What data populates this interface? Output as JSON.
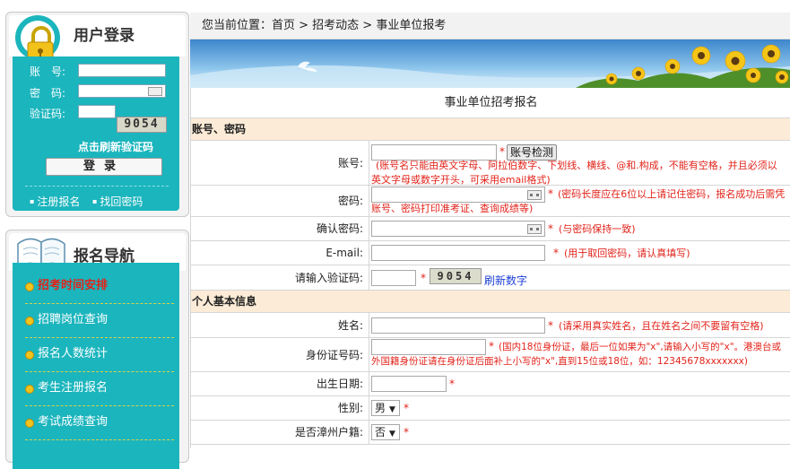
{
  "login": {
    "title": "用户登录",
    "account_label": "账　号:",
    "password_label": "密　码:",
    "captcha_label": "验证码:",
    "captcha_text": "9054",
    "refresh_link": "点击刷新验证码",
    "login_button": "登录",
    "register_link": "注册报名",
    "forgot_link": "找回密码"
  },
  "nav": {
    "title": "报名导航",
    "items": [
      {
        "label": "招考时间安排",
        "active": true
      },
      {
        "label": "招聘岗位查询"
      },
      {
        "label": "报名人数统计"
      },
      {
        "label": "考生注册报名"
      },
      {
        "label": "考试成绩查询"
      }
    ]
  },
  "breadcrumb": "您当前位置：首页 > 招考动态 > 事业单位报考",
  "form": {
    "title": "事业单位招考报名",
    "section_account": "账号、密码",
    "account_label": "账号:",
    "check_button": "账号检测",
    "account_note": "(账号名只能由英文字母、阿拉伯数字、下划线、横线、@和.构成，不能有空格，并且必须以英文字母或数字开头，可采用email格式)",
    "password_label": "密码:",
    "password_note": "(密码长度应在6位以上请记住密码，报名成功后需凭账号、密码打印准考证、查询成绩等)",
    "confirm_label": "确认密码:",
    "confirm_note": "(与密码保持一致)",
    "email_label": "E-mail:",
    "email_note": "(用于取回密码，请认真填写)",
    "captcha_label": "请输入验证码:",
    "captcha_text": "9054",
    "refresh_label": "刷新数字",
    "section_personal": "个人基本信息",
    "name_label": "姓名:",
    "name_note": "(请采用真实姓名，且在姓名之间不要留有空格)",
    "id_label": "身份证号码:",
    "id_note": "(国内18位身份证，最后一位如果为\"x\",请输入小写的\"x\"。港澳台或外国籍身份证请在身份证后面补上小写的\"x\",直到15位或18位，如：12345678xxxxxxx)",
    "birth_label": "出生日期:",
    "gender_label": "性别:",
    "gender_value": "男",
    "hukou_label": "是否漳州户籍:",
    "hukou_value": "否",
    "required_mark": "*"
  },
  "colors": {
    "teal": "#1bb5bd",
    "section_bg": "#fcebd6",
    "required": "#e2231a",
    "link": "#1c3fd6"
  }
}
